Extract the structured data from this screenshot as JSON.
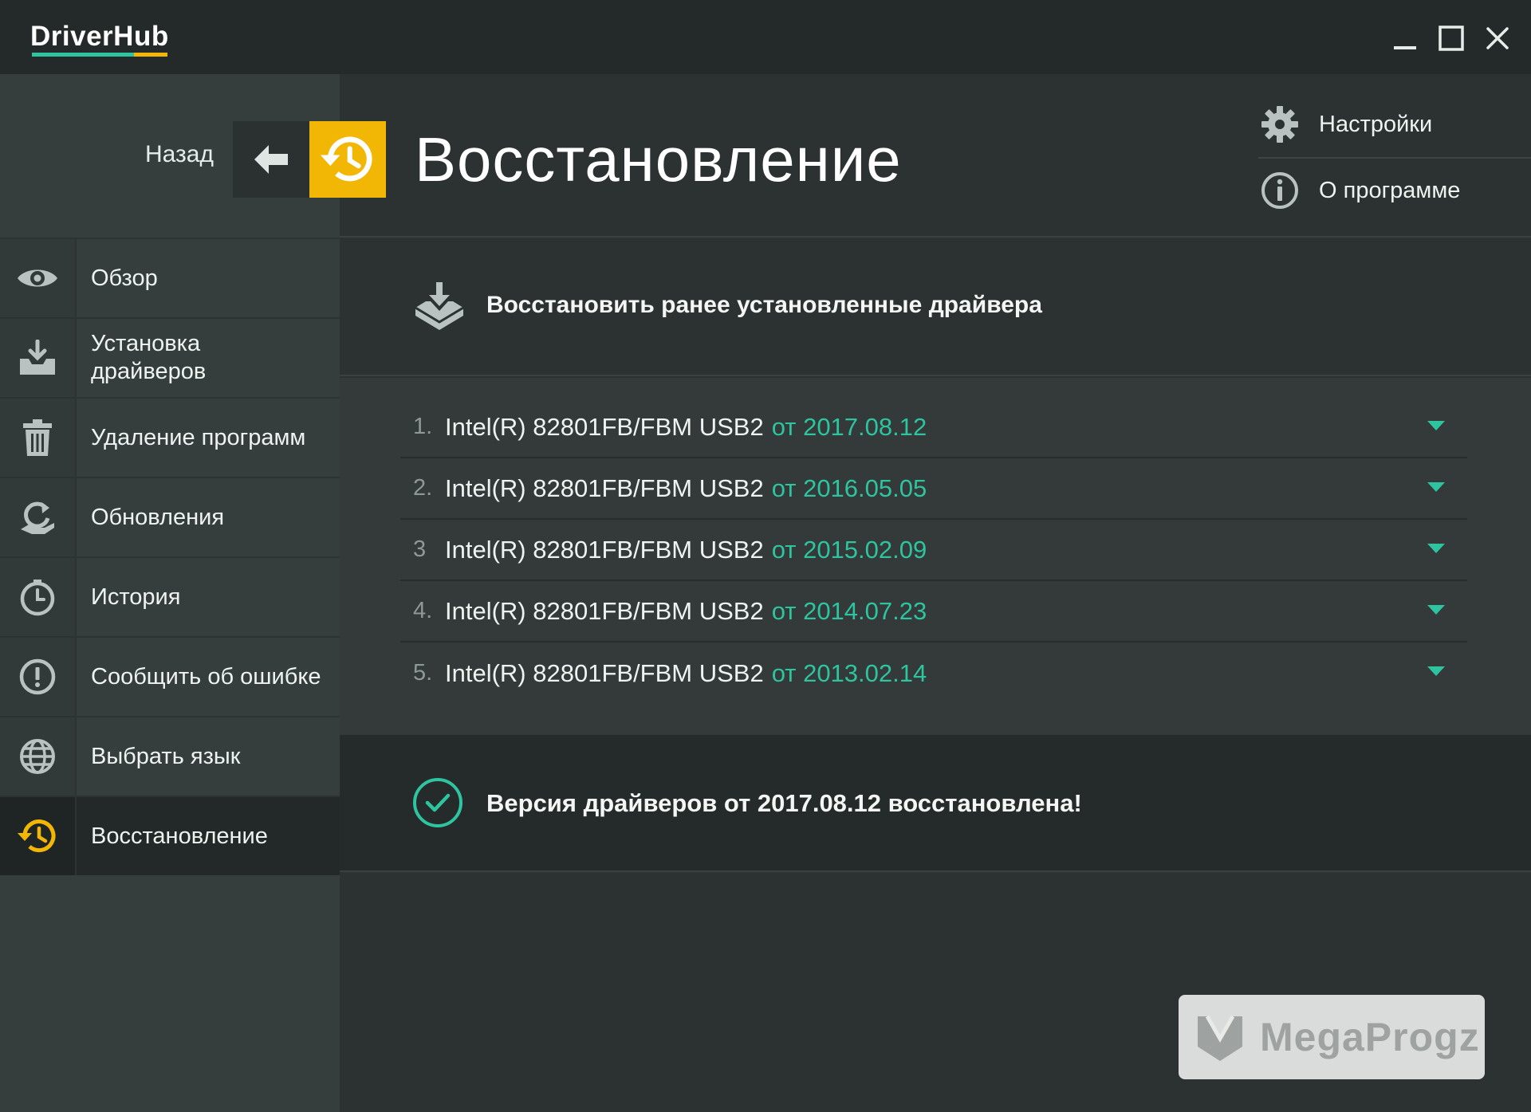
{
  "app": {
    "logo": "DriverHub",
    "brand_colors": [
      "#2ec4a0",
      "#f2b705"
    ]
  },
  "window_controls": {
    "minimize": "minimize-icon",
    "maximize": "maximize-icon",
    "close": "close-icon"
  },
  "sidebar": {
    "back_label": "Назад",
    "items": [
      {
        "label": "Обзор",
        "icon": "eye-icon"
      },
      {
        "label": "Установка\nдрайверов",
        "icon": "install-tray-icon"
      },
      {
        "label": "Удаление программ",
        "icon": "trash-icon"
      },
      {
        "label": "Обновления",
        "icon": "update-icon"
      },
      {
        "label": "История",
        "icon": "clock-icon"
      },
      {
        "label": "Сообщить об ошибке",
        "icon": "alert-icon"
      },
      {
        "label": "Выбрать язык",
        "icon": "globe-icon"
      },
      {
        "label": "Восстановление",
        "icon": "restore-icon",
        "active": true
      }
    ]
  },
  "header": {
    "title": "Восстановление",
    "settings_label": "Настройки",
    "about_label": "О программе"
  },
  "restore": {
    "section_title": "Восстановить ранее установленные драйвера",
    "drivers": [
      {
        "num": "1.",
        "name": "Intel(R) 82801FB/FBM USB2",
        "date": "от 2017.08.12"
      },
      {
        "num": "2.",
        "name": "Intel(R) 82801FB/FBM USB2",
        "date": "от 2016.05.05"
      },
      {
        "num": "3",
        "name": "Intel(R) 82801FB/FBM USB2",
        "date": "от 2015.02.09"
      },
      {
        "num": "4.",
        "name": "Intel(R) 82801FB/FBM USB2",
        "date": "от 2014.07.23"
      },
      {
        "num": "5.",
        "name": "Intel(R) 82801FB/FBM USB2",
        "date": "от 2013.02.14"
      }
    ],
    "status_message": "Версия драйверов от 2017.08.12 восстановлена!"
  },
  "watermark": {
    "text": "MegaProgz"
  }
}
